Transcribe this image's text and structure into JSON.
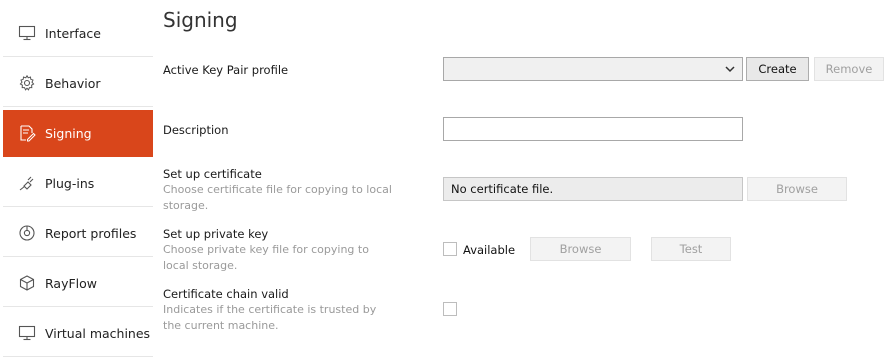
{
  "sidebar": {
    "items": [
      {
        "label": "Interface",
        "icon": "monitor-icon"
      },
      {
        "label": "Behavior",
        "icon": "gear-icon"
      },
      {
        "label": "Signing",
        "icon": "signature-icon",
        "active": true
      },
      {
        "label": "Plug-ins",
        "icon": "plug-icon"
      },
      {
        "label": "Report profiles",
        "icon": "report-icon"
      },
      {
        "label": "RayFlow",
        "icon": "cube-icon"
      },
      {
        "label": "Virtual machines",
        "icon": "monitor-icon"
      }
    ]
  },
  "page": {
    "title": "Signing"
  },
  "key_pair": {
    "label": "Active Key Pair profile",
    "selected_value": "",
    "create_label": "Create",
    "remove_label": "Remove"
  },
  "description": {
    "label": "Description",
    "value": ""
  },
  "certificate": {
    "label": "Set up certificate",
    "hint": "Choose certificate file for copying to local storage.",
    "file_text": "No certificate file.",
    "browse_label": "Browse"
  },
  "private_key": {
    "label": "Set up private key",
    "hint": "Choose private key file for copying to local storage.",
    "available_label": "Available",
    "browse_label": "Browse",
    "test_label": "Test"
  },
  "chain": {
    "label": "Certificate chain valid",
    "hint": "Indicates if the certificate is trusted by the current machine."
  },
  "colors": {
    "accent": "#d9461b"
  }
}
